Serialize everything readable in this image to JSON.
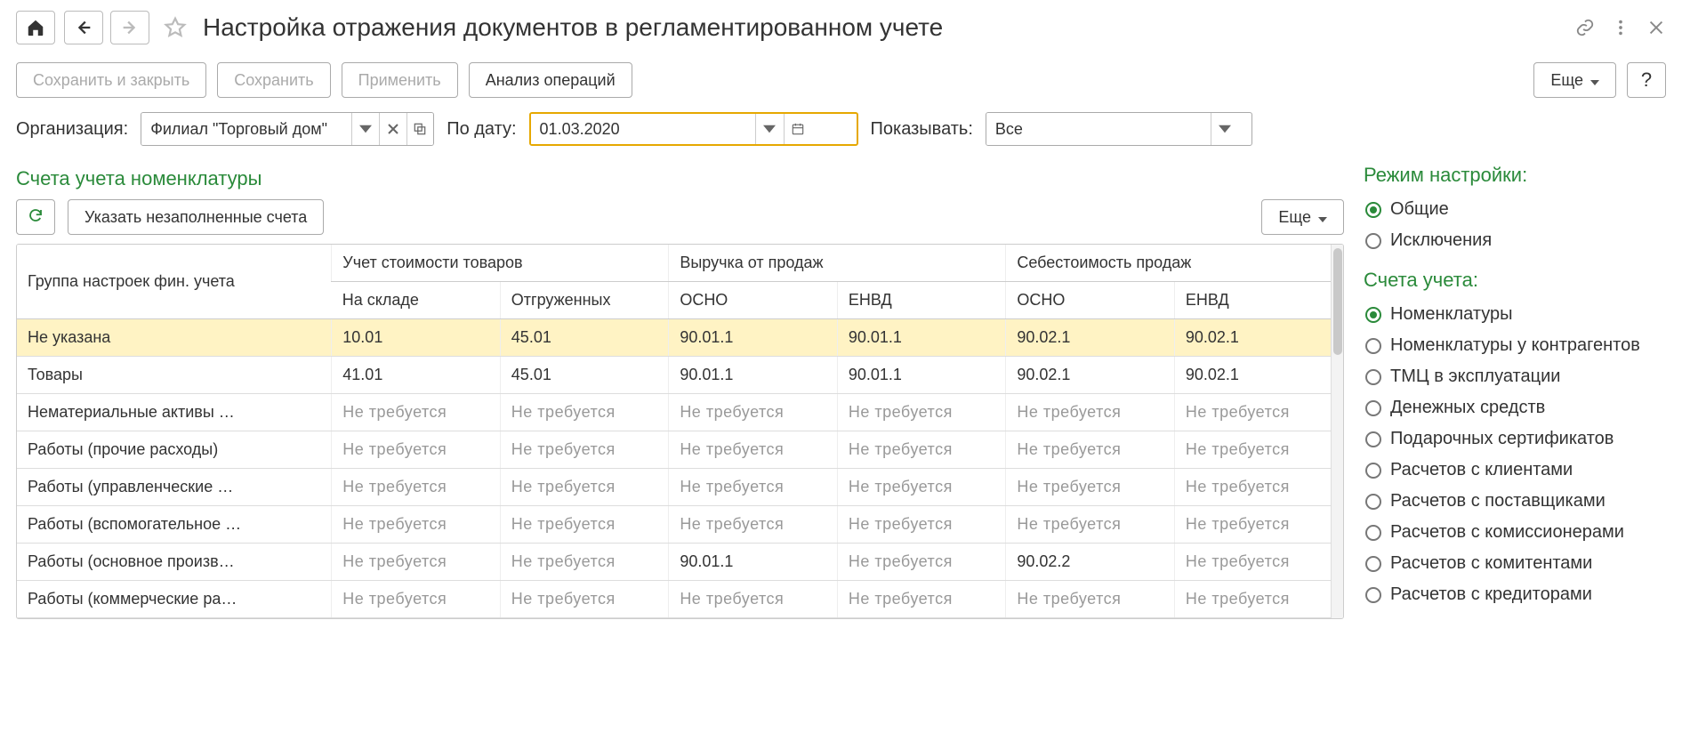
{
  "header": {
    "title": "Настройка отражения документов в регламентированном учете"
  },
  "toolbar": {
    "save_close": "Сохранить и закрыть",
    "save": "Сохранить",
    "apply": "Применить",
    "analyze": "Анализ операций",
    "more": "Еще",
    "help": "?"
  },
  "filters": {
    "org_label": "Организация:",
    "org_value": "Филиал \"Торговый дом\"",
    "date_label": "По дату:",
    "date_value": "01.03.2020",
    "show_label": "Показывать:",
    "show_value": "Все"
  },
  "section": {
    "title": "Счета учета номенклатуры",
    "fill_empty": "Указать незаполненные счета",
    "more": "Еще"
  },
  "table": {
    "not_required": "Не требуется",
    "headers": {
      "group": "Группа настроек фин. учета",
      "cost": "Учет стоимости товаров",
      "cost_stock": "На складе",
      "cost_shipped": "Отгруженных",
      "revenue": "Выручка от продаж",
      "rev_osno": "ОСНО",
      "rev_envd": "ЕНВД",
      "cogs": "Себестоимость продаж",
      "cogs_osno": "ОСНО",
      "cogs_envd": "ЕНВД"
    },
    "rows": [
      {
        "group": "Не указана",
        "selected": true,
        "stock": "10.01",
        "shipped": "45.01",
        "rev_osno": "90.01.1",
        "rev_envd": "90.01.1",
        "cogs_osno": "90.02.1",
        "cogs_envd": "90.02.1"
      },
      {
        "group": "Товары",
        "stock": "41.01",
        "shipped": "45.01",
        "rev_osno": "90.01.1",
        "rev_envd": "90.01.1",
        "cogs_osno": "90.02.1",
        "cogs_envd": "90.02.1"
      },
      {
        "group": "Нематериальные активы …",
        "stock": null,
        "shipped": null,
        "rev_osno": null,
        "rev_envd": null,
        "cogs_osno": null,
        "cogs_envd": null
      },
      {
        "group": "Работы (прочие расходы)",
        "stock": null,
        "shipped": null,
        "rev_osno": null,
        "rev_envd": null,
        "cogs_osno": null,
        "cogs_envd": null
      },
      {
        "group": "Работы (управленческие …",
        "stock": null,
        "shipped": null,
        "rev_osno": null,
        "rev_envd": null,
        "cogs_osno": null,
        "cogs_envd": null
      },
      {
        "group": "Работы (вспомогательное …",
        "stock": null,
        "shipped": null,
        "rev_osno": null,
        "rev_envd": null,
        "cogs_osno": null,
        "cogs_envd": null
      },
      {
        "group": "Работы (основное произв…",
        "stock": null,
        "shipped": null,
        "rev_osno": "90.01.1",
        "rev_envd": null,
        "cogs_osno": "90.02.2",
        "cogs_envd": null
      },
      {
        "group": "Работы (коммерческие ра…",
        "stock": null,
        "shipped": null,
        "rev_osno": null,
        "rev_envd": null,
        "cogs_osno": null,
        "cogs_envd": null
      }
    ]
  },
  "sidebar": {
    "mode_title": "Режим настройки:",
    "mode_items": [
      {
        "label": "Общие",
        "selected": true
      },
      {
        "label": "Исключения",
        "selected": false
      }
    ],
    "accounts_title": "Счета учета:",
    "accounts_items": [
      {
        "label": "Номенклатуры",
        "selected": true
      },
      {
        "label": "Номенклатуры у контрагентов"
      },
      {
        "label": "ТМЦ в эксплуатации"
      },
      {
        "label": "Денежных средств"
      },
      {
        "label": "Подарочных сертификатов"
      },
      {
        "label": "Расчетов с клиентами"
      },
      {
        "label": "Расчетов с поставщиками"
      },
      {
        "label": "Расчетов с комиссионерами"
      },
      {
        "label": "Расчетов с комитентами"
      },
      {
        "label": "Расчетов с кредиторами"
      }
    ]
  }
}
